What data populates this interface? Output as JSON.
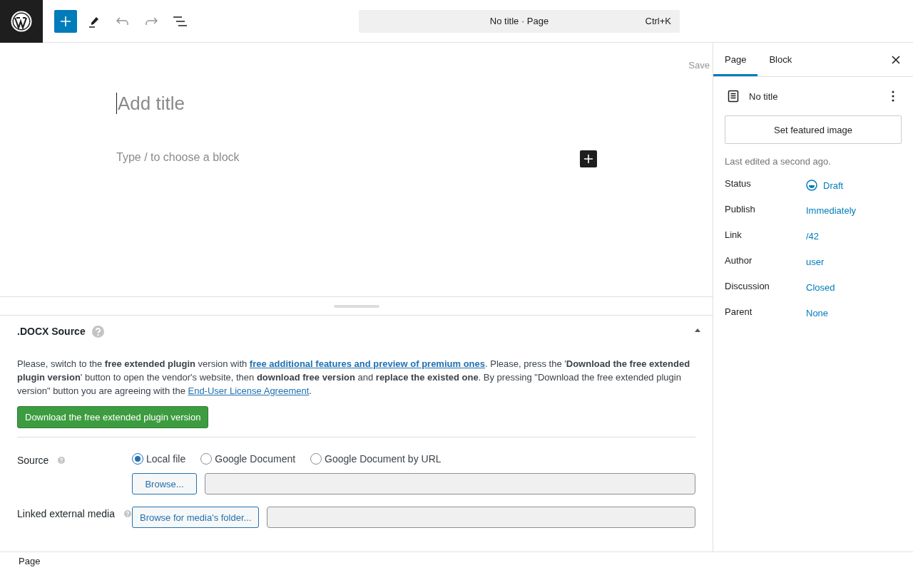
{
  "toolbar": {
    "command_bar": {
      "title": "No title · Page",
      "shortcut": "Ctrl+K"
    }
  },
  "editor": {
    "save": "Save",
    "title_placeholder": "Add title",
    "block_placeholder": "Type / to choose a block"
  },
  "metabox": {
    "title": ".DOCX Source",
    "expanded": true,
    "notice": [
      {
        "kind": "text",
        "text": "Please, switch to the **free extended plugin** version with "
      },
      {
        "kind": "link",
        "text": "free additional features and preview of premium ones",
        "bold": true
      },
      {
        "kind": "text",
        "text": ". Please, press the '**Download the free extended plugin version**' button to open the vendor's website, then **download free version** and **replace the existed one**. By pressing \"Download the free extended plugin version\" button you are agreeing with the "
      },
      {
        "kind": "link",
        "text": "End-User License Agreement",
        "bold": false
      },
      {
        "kind": "text",
        "text": "."
      }
    ],
    "download_button": "Download the free extended plugin version",
    "source_label": "Source",
    "source_options": [
      {
        "label": "Local file",
        "selected": true
      },
      {
        "label": "Google Document",
        "selected": false
      },
      {
        "label": "Google Document by URL",
        "selected": false
      }
    ],
    "browse_button": "Browse...",
    "media_label": "Linked external media",
    "media_button": "Browse for media's folder..."
  },
  "sidebar": {
    "tabs": [
      {
        "label": "Page",
        "selected": true
      },
      {
        "label": "Block",
        "selected": false
      }
    ],
    "doc_title": "No title",
    "featured_button": "Set featured image",
    "last_edited": "Last edited a second ago.",
    "rows": [
      {
        "label": "Status",
        "value": "Draft",
        "kind": "status"
      },
      {
        "label": "Publish",
        "value": "Immediately",
        "kind": "link"
      },
      {
        "label": "Link",
        "value": "/42",
        "kind": "link"
      },
      {
        "label": "Author",
        "value": "user",
        "kind": "link"
      },
      {
        "label": "Discussion",
        "value": "Closed",
        "kind": "link"
      },
      {
        "label": "Parent",
        "value": "None",
        "kind": "link"
      }
    ]
  },
  "footer": {
    "breadcrumb": "Page"
  }
}
